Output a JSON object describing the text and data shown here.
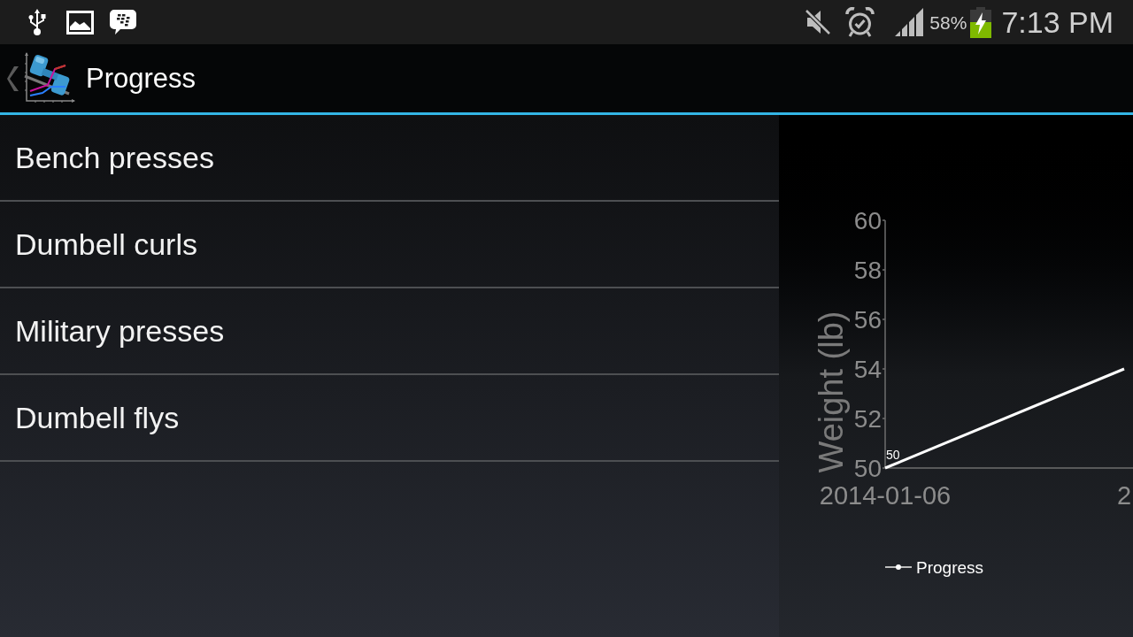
{
  "status_bar": {
    "battery_percent": "58%",
    "time": "7:13 PM"
  },
  "action_bar": {
    "title": "Progress"
  },
  "exercises": [
    "Bench presses",
    "Dumbell curls",
    "Military presses",
    "Dumbell flys"
  ],
  "chart": {
    "chart_data": {
      "type": "line",
      "ylabel": "Weight (lb)",
      "categories": [
        "2014-01-06",
        "2"
      ],
      "ylim": [
        50,
        60
      ],
      "yticks": [
        50,
        52,
        54,
        56,
        58,
        60
      ],
      "series": [
        {
          "name": "Progress",
          "color": "#ffffff",
          "values": [
            50,
            54
          ]
        }
      ],
      "value_labels": [
        "50",
        null
      ]
    }
  }
}
